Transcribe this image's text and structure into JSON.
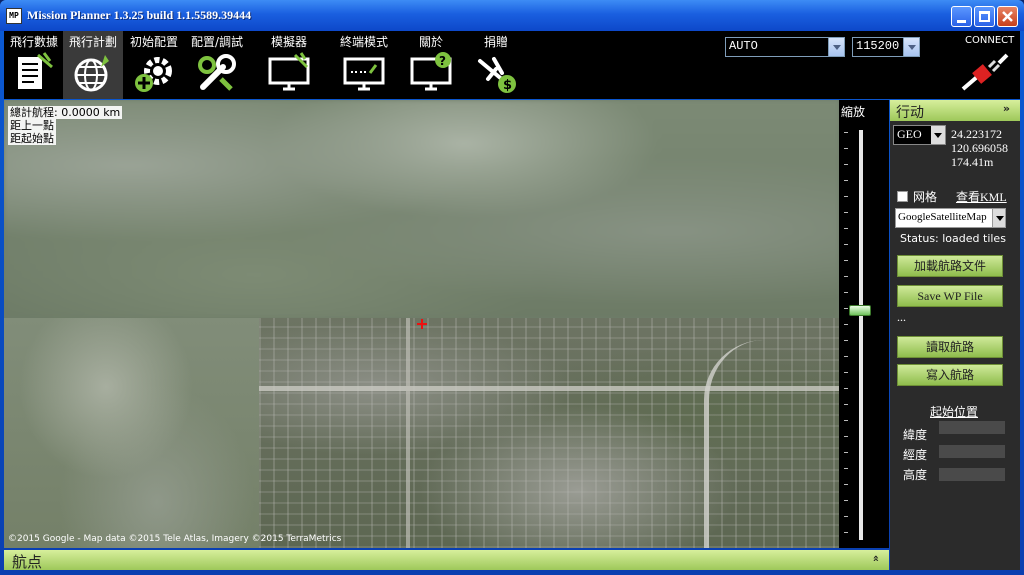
{
  "window": {
    "title": "Mission Planner 1.3.25 build 1.1.5589.39444",
    "app_icon_text": "MP"
  },
  "toolbar": {
    "items": [
      {
        "label": "飛行數據",
        "icon": "flight-data-icon"
      },
      {
        "label": "飛行計劃",
        "icon": "flight-plan-globe-icon",
        "selected": true
      },
      {
        "label": "初始配置",
        "icon": "initial-setup-gear-icon"
      },
      {
        "label": "配置/調試",
        "icon": "config-tuning-wrench-icon"
      },
      {
        "label": "模擬器",
        "icon": "simulation-monitor-icon"
      },
      {
        "label": "終端模式",
        "icon": "terminal-monitor-icon"
      },
      {
        "label": "關於",
        "icon": "help-monitor-icon"
      },
      {
        "label": "捐贈",
        "icon": "donate-plane-icon"
      }
    ],
    "mode_select": "AUTO",
    "baud_select": "115200",
    "connect_label": "CONNECT"
  },
  "map": {
    "total_distance": "總計航程: 0.0000 km",
    "prev_point": "距上一點",
    "home_distance": "距起始點",
    "copyright": "©2015 Google - Map data ©2015 Tele Atlas, Imagery ©2015 TerraMetrics"
  },
  "zoom": {
    "label": "縮放"
  },
  "panel": {
    "title": "行动",
    "collapse": "»",
    "coord_system": "GEO",
    "lat": "24.223172",
    "lng": "120.696058",
    "alt": "174.41m",
    "grid_label": "网格",
    "view_kml": "查看KML",
    "map_type": "GoogleSatelliteMap",
    "status": "Status: loaded tiles",
    "load_wp_file": "加載航路文件",
    "save_wp_file": "Save WP File",
    "ellipsis": "...",
    "read_wps": "讀取航路",
    "write_wps": "寫入航路",
    "home_location": "起始位置",
    "lat_label": "緯度",
    "lng_label": "經度",
    "alt_label": "高度"
  },
  "bottom": {
    "title": "航点",
    "expand": "»"
  },
  "colors": {
    "accent_green": "#9ec85a",
    "titlebar_blue": "#1a5fe0"
  }
}
